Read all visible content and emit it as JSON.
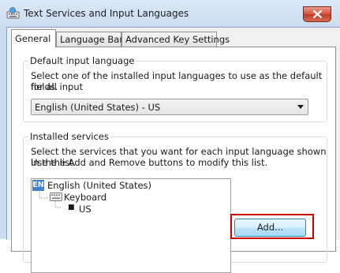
{
  "window": {
    "title": "Text Services and Input Languages",
    "icon": "keyboard-globe-icon"
  },
  "tabs": [
    {
      "label": "General",
      "active": true
    },
    {
      "label": "Language Bar",
      "active": false
    },
    {
      "label": "Advanced Key Settings",
      "active": false
    }
  ],
  "default_language": {
    "group_title": "Default input language",
    "description_line1": "Select one of the installed input languages to use as the default for all input",
    "description_line2": "fields.",
    "selected": "English (United States) - US"
  },
  "installed_services": {
    "group_title": "Installed services",
    "description_line1": "Select the services that you want for each input language shown in the list.",
    "description_line2": "Use the Add and Remove buttons to modify this list.",
    "tree": {
      "language_code": "EN",
      "language": "English (United States)",
      "category": "Keyboard",
      "layout": "US"
    },
    "add_label": "Add..."
  },
  "colors": {
    "accent": "#3f7fd0",
    "highlight": "#cc0000"
  }
}
